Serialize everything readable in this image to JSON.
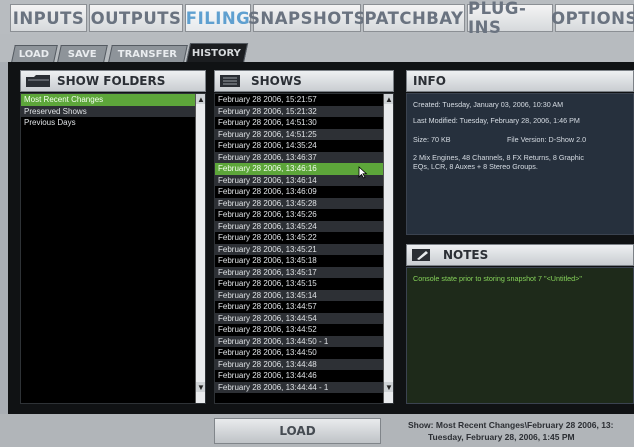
{
  "top_tabs": [
    {
      "label": "INPUTS"
    },
    {
      "label": "OUTPUTS"
    },
    {
      "label": "FILING"
    },
    {
      "label": "SNAPSHOTS"
    },
    {
      "label": "PATCHBAY"
    },
    {
      "label": "PLUG-INS"
    },
    {
      "label": "OPTIONS"
    }
  ],
  "active_top_tab": "FILING",
  "sub_tabs": [
    {
      "label": "LOAD"
    },
    {
      "label": "SAVE"
    },
    {
      "label": "TRANSFER"
    },
    {
      "label": "HISTORY"
    }
  ],
  "active_sub_tab": "HISTORY",
  "show_folders": {
    "title": "SHOW FOLDERS",
    "items": [
      "Most Recent Changes",
      "Preserved Shows",
      "Previous Days"
    ],
    "selected_index": 0
  },
  "shows": {
    "title": "SHOWS",
    "items": [
      "February 28 2006, 15:21:57",
      "February 28 2006, 15:21:32",
      "February 28 2006, 14:51:30",
      "February 28 2006, 14:51:25",
      "February 28 2006, 14:35:24",
      "February 28 2006, 13:46:37",
      "February 28 2006, 13:46:16",
      "February 28 2006, 13:46:14",
      "February 28 2006, 13:46:09",
      "February 28 2006, 13:45:28",
      "February 28 2006, 13:45:26",
      "February 28 2006, 13:45:24",
      "February 28 2006, 13:45:22",
      "February 28 2006, 13:45:21",
      "February 28 2006, 13:45:18",
      "February 28 2006, 13:45:17",
      "February 28 2006, 13:45:15",
      "February 28 2006, 13:45:14",
      "February 28 2006, 13:44:57",
      "February 28 2006, 13:44:54",
      "February 28 2006, 13:44:52",
      "February 28 2006, 13:44:50 - 1",
      "February 28 2006, 13:44:50",
      "February 28 2006, 13:44:48",
      "February 28 2006, 13:44:46",
      "February 28 2006, 13:44:44 - 1"
    ],
    "selected_index": 6
  },
  "info": {
    "title": "INFO",
    "created": "Created: Tuesday, January 03, 2006, 10:30 AM",
    "last_modified": "Last Modified: Tuesday, February 28, 2006, 1:46 PM",
    "size": "Size: 70 KB",
    "file_version": "File Version: D-Show 2.0",
    "config_line1": "2 Mix Engines, 48 Channels, 8 FX Returns, 8 Graphic",
    "config_line2": "EQs, LCR, 8 Auxes + 8 Stereo Groups."
  },
  "notes": {
    "title": "NOTES",
    "text": "Console state prior to storing snapshot 7 \"<Untitled>\""
  },
  "load_button": "LOAD",
  "status": {
    "line1": "Show: Most Recent Changes\\February 28 2006, 13:",
    "line2": "Tuesday, February 28, 2006, 1:45 PM"
  },
  "icons": {
    "folder": "folder-icon",
    "shows": "document-list-icon",
    "notes": "pencil-note-icon",
    "cursor": "mouse-pointer-icon"
  }
}
